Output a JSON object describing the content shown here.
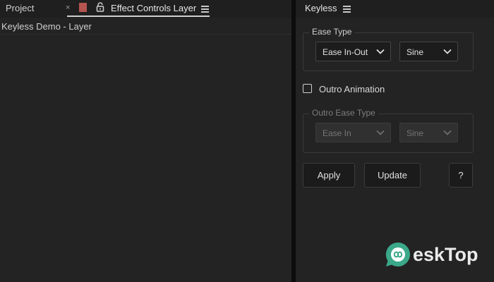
{
  "left_panel": {
    "tabs": {
      "project_label": "Project",
      "close_glyph": "×",
      "label_color": "#b45550",
      "effect_controls_label": "Effect Controls Layer"
    },
    "layer_title": "Keyless Demo - Layer"
  },
  "right_panel": {
    "tab_label": "Keyless",
    "ease_group": {
      "legend": "Ease Type",
      "ease_dropdown_value": "Ease In-Out",
      "curve_dropdown_value": "Sine"
    },
    "outro_checkbox": {
      "label": "Outro Animation",
      "checked": false
    },
    "outro_group": {
      "legend": "Outro Ease Type",
      "ease_dropdown_value": "Ease In",
      "curve_dropdown_value": "Sine",
      "disabled": true
    },
    "buttons": {
      "apply_label": "Apply",
      "update_label": "Update",
      "help_label": "?"
    }
  },
  "watermark": {
    "text": "eskTop",
    "logo_color": "#3aa889"
  },
  "colors": {
    "panel_bg": "#232323",
    "tabbar_bg": "#1f1f1f",
    "splitter": "#0c0c0c"
  }
}
